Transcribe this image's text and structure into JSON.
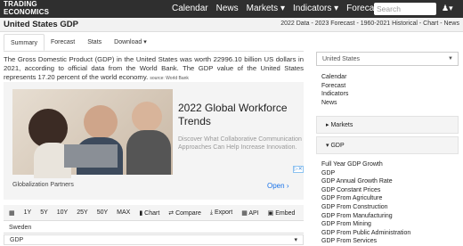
{
  "brand": {
    "logo_line1": "TRADING",
    "logo_line2": "ECONOMICS"
  },
  "nav": {
    "items": [
      "Calendar",
      "News",
      "Markets",
      "Indicators",
      "Forecasts"
    ],
    "search_placeholder": "Search"
  },
  "page": {
    "title": "United States GDP",
    "links": "2022 Data - 2023 Forecast - 1960-2021 Historical - Chart - News"
  },
  "tabs": [
    "Summary",
    "Forecast",
    "Stats",
    "Download"
  ],
  "summary": {
    "text": "The Gross Domestic Product (GDP) in the United States was worth 22996.10 billion US dollars in 2021, according to official data from the World Bank. The GDP value of the United States represents 17.20 percent of the world economy.",
    "source": "source: World Bank"
  },
  "ad": {
    "headline": "2022 Global Workforce Trends",
    "subtext": "Discover What Collaborative Communication Approaches Can Help Increase Innovation.",
    "advertiser": "Globalization Partners",
    "cta": "Open"
  },
  "chart_toolbar": {
    "items": [
      "1Y",
      "5Y",
      "10Y",
      "25Y",
      "50Y",
      "MAX",
      "Chart",
      "Compare",
      "Export",
      "API",
      "Embed"
    ]
  },
  "selectors": {
    "country": "Sweden",
    "indicator": "GDP"
  },
  "sidebar": {
    "country_select": "United States",
    "links": [
      "Calendar",
      "Forecast",
      "Indicators",
      "News"
    ],
    "markets_label": "Markets",
    "gdp_label": "GDP",
    "gdp_links": [
      "Full Year GDP Growth",
      "GDP",
      "GDP Annual Growth Rate",
      "GDP Constant Prices",
      "GDP From Agriculture",
      "GDP From Construction",
      "GDP From Manufacturing",
      "GDP From Mining",
      "GDP From Public Administration",
      "GDP From Services"
    ]
  }
}
